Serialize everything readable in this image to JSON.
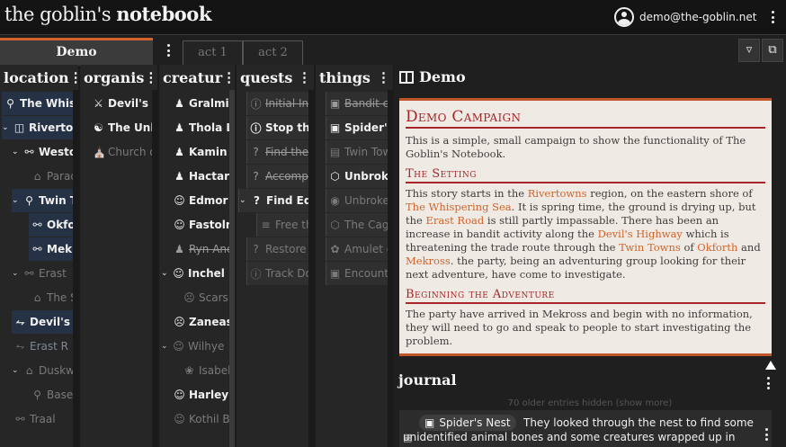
{
  "app": {
    "brand_light": "the goblin's ",
    "brand_bold": "notebook"
  },
  "account": {
    "email": "demo@the-goblin.net",
    "icon": "account-circle-icon"
  },
  "tabs": {
    "active": "Demo",
    "inactive": [
      "act 1",
      "act 2"
    ]
  },
  "toolbar": {
    "filter_icon": "filter-icon",
    "windows_icon": "windows-icon"
  },
  "columns": {
    "location": {
      "title": "location",
      "items": [
        {
          "label": "The Whis",
          "icon": "pin-icon"
        },
        {
          "label": "Rivertown",
          "icon": "columns-icon"
        },
        {
          "label": "Westow",
          "icon": "person-icon"
        },
        {
          "label": "Parad",
          "icon": "house-icon"
        },
        {
          "label": "Twin To",
          "icon": "pin-icon"
        },
        {
          "label": "Okfor",
          "icon": "person-icon"
        },
        {
          "label": "Mekr",
          "icon": "person-icon"
        },
        {
          "label": "Erast",
          "icon": "person-icon"
        },
        {
          "label": "The S",
          "icon": "house-icon"
        },
        {
          "label": "Devil's",
          "icon": "signpost-icon"
        },
        {
          "label": "Erast R",
          "icon": "signpost-icon"
        },
        {
          "label": "Duskw",
          "icon": "house-icon"
        },
        {
          "label": "Baser",
          "icon": "pin-icon"
        },
        {
          "label": "Traal",
          "icon": "person-icon"
        }
      ]
    },
    "organisations": {
      "title": "organis",
      "items": [
        {
          "label": "Devil's Pr",
          "icon": "swords-icon"
        },
        {
          "label": "The Unbr",
          "icon": "group-icon"
        },
        {
          "label": "Church o",
          "icon": "church-icon"
        }
      ]
    },
    "creatures": {
      "title": "creatur",
      "items": [
        {
          "label": "Gralmir T",
          "icon": "person-icon"
        },
        {
          "label": "Thola Lia",
          "icon": "person-icon"
        },
        {
          "label": "Kamin Fa",
          "icon": "person-icon"
        },
        {
          "label": "Hactar",
          "icon": "person-icon"
        },
        {
          "label": "Edmor G",
          "icon": "smile-icon"
        },
        {
          "label": "Fastolm",
          "icon": "smile-icon"
        },
        {
          "label": "Ryn Anci",
          "icon": "person-icon"
        },
        {
          "label": "Inchel Ke",
          "icon": "smile-icon"
        },
        {
          "label": "Scars",
          "icon": "frown-icon"
        },
        {
          "label": "Zaneas",
          "icon": "frown-icon"
        },
        {
          "label": "Wilhye",
          "icon": "smile-icon"
        },
        {
          "label": "Isabelle",
          "icon": "paw-icon"
        },
        {
          "label": "Harley Re",
          "icon": "smile-icon"
        },
        {
          "label": "Kothil Ba",
          "icon": "smile-icon"
        }
      ]
    },
    "quests": {
      "title": "quests",
      "items": [
        {
          "label": "Initial Inv",
          "icon": "question-icon"
        },
        {
          "label": "Stop the",
          "icon": "question-icon"
        },
        {
          "label": "Find the",
          "icon": "question-icon"
        },
        {
          "label": "Accomps",
          "icon": "question-icon"
        },
        {
          "label": "Find Edm",
          "icon": "question-icon"
        },
        {
          "label": "Free th",
          "icon": "list-icon"
        },
        {
          "label": "Restore I",
          "icon": "question-icon"
        },
        {
          "label": "Track Do",
          "icon": "question-icon"
        }
      ]
    },
    "things": {
      "title": "things",
      "items": [
        {
          "label": "Bandit cr",
          "icon": "image-icon"
        },
        {
          "label": "Spider's I",
          "icon": "image-icon"
        },
        {
          "label": "Twin Tow",
          "icon": "document-icon"
        },
        {
          "label": "Unbroker",
          "icon": "cube-icon"
        },
        {
          "label": "Unbroken",
          "icon": "disc-icon"
        },
        {
          "label": "The Cage",
          "icon": "cube-icon"
        },
        {
          "label": "Amulet o",
          "icon": "amulet-icon"
        },
        {
          "label": "Encounte",
          "icon": "image-icon"
        }
      ]
    }
  },
  "panel": {
    "title": "Demo",
    "document": {
      "title": "Demo Campaign",
      "intro": "This is a simple, small campaign to show the functionality of The Goblin's Notebook.",
      "setting_heading": "The Setting",
      "setting": {
        "p1": "This story starts in the ",
        "l1": "Rivertowns",
        "p2": " region, on the eastern shore of ",
        "l2": "The Whispering Sea",
        "p3": ". It is spring time, the ground is drying up, but the ",
        "l3": "Erast Road",
        "p4": " is still partly impassable. There has been an increase in bandit activity along the ",
        "l4": "Devil's Highway",
        "p5": " which is threatening the trade route through the ",
        "l5": "Twin Towns",
        "p6": " of ",
        "l6": "Okforth",
        "p7": " and ",
        "l7": "Mekross",
        "p8": ". the party, being an adventuring group looking for their next adventure, have come to investigate."
      },
      "beginning_heading": "Beginning the Adventure",
      "beginning": "The party have arrived in Mekross and begin with no information, they will need to go and speak to people to start investigating the problem."
    },
    "journal_title": "journal",
    "older_entries": "70 older entries hidden (show more)",
    "entry": {
      "chip_label": "Spider's Nest",
      "text": "They looked through the nest to find some unidentified animal bones and some creatures wrapped up in"
    }
  }
}
